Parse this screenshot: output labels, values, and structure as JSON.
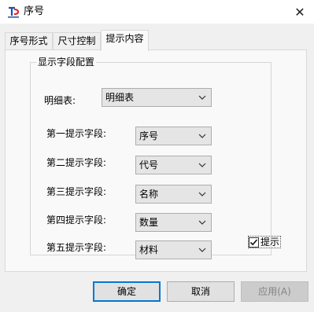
{
  "window": {
    "title": "序号",
    "close_glyph": "✕"
  },
  "tabs": [
    {
      "label": "序号形式",
      "active": false
    },
    {
      "label": "尺寸控制",
      "active": false
    },
    {
      "label": "提示内容",
      "active": true
    }
  ],
  "group": {
    "legend": "显示字段配置",
    "detail_table": {
      "label": "明细表:",
      "value": "明细表"
    },
    "fields": [
      {
        "label": "第一提示字段:",
        "value": "序号"
      },
      {
        "label": "第二提示字段:",
        "value": "代号"
      },
      {
        "label": "第三提示字段:",
        "value": "名称"
      },
      {
        "label": "第四提示字段:",
        "value": "数量"
      },
      {
        "label": "第五提示字段:",
        "value": "材料"
      }
    ]
  },
  "prompt_checkbox": {
    "label": "提示",
    "checked": true
  },
  "buttons": {
    "ok": "确定",
    "cancel": "取消",
    "apply": "应用(A)",
    "apply_enabled": false
  },
  "colors": {
    "accent": "#0078d7",
    "disabled_text": "#838383",
    "logo_red": "#e02020",
    "logo_blue": "#1e4fa8"
  },
  "icons": {
    "app": "app-logo-icon",
    "close": "close-icon",
    "dropdown": "chevron-down-icon",
    "check": "checkmark-icon"
  }
}
